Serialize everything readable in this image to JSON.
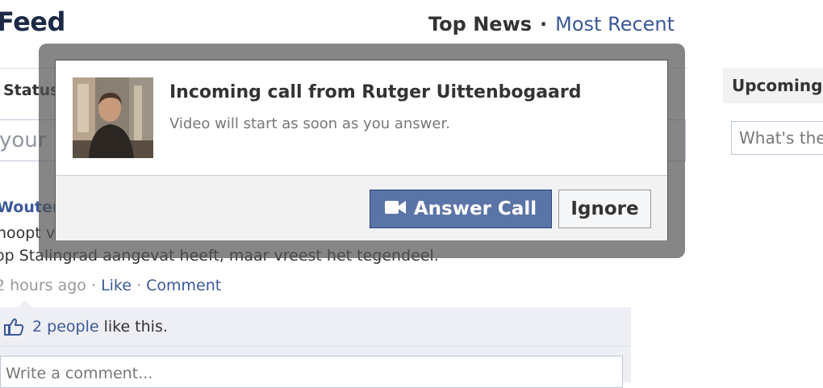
{
  "header": {
    "title": "Feed",
    "tab_top": "Top News",
    "tab_separator": "·",
    "tab_recent": "Most Recent"
  },
  "composer": {
    "status_label": "Status",
    "placeholder": "your"
  },
  "sidebar": {
    "upcoming_label": "Upcoming",
    "whats_placeholder": "What's the"
  },
  "story": {
    "author": "Wouter",
    "line1": "hoopt v",
    "line2": "op Stalingrad aangevat heeft, maar vreest het tegendeel.",
    "time": "2 hours ago",
    "sep": "·",
    "like": "Like",
    "comment": "Comment",
    "likes_people": "2 people",
    "likes_rest": " like this.",
    "comment_placeholder": "Write a comment..."
  },
  "dialog": {
    "title": "Incoming call from Rutger Uittenbogaard",
    "subtitle": "Video will start as soon as you answer.",
    "answer_label": "Answer Call",
    "ignore_label": "Ignore",
    "answer_icon": "video-camera-icon"
  },
  "colors": {
    "link": "#3b5998",
    "button_primary": "#5b74a8",
    "overlay": "#525252"
  }
}
